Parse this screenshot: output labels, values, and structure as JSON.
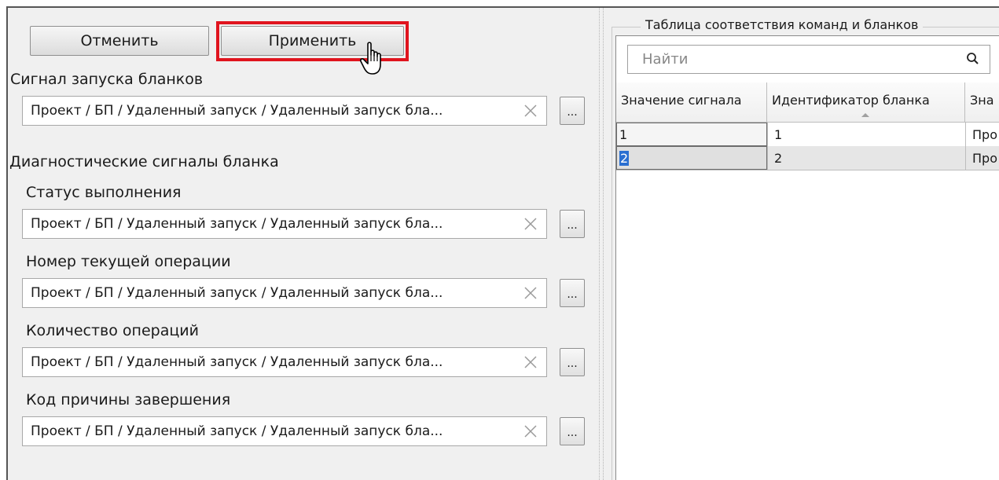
{
  "toolbar": {
    "cancel_label": "Отменить",
    "apply_label": "Применить"
  },
  "left": {
    "start_signal_label": "Сигнал запуска бланков",
    "start_signal_value": "Проект / БП / Удаленный запуск / Удаленный запуск бла...",
    "diag_section_label": "Диагностические сигналы бланка",
    "fields": [
      {
        "label": "Статус выполнения",
        "value": "Проект / БП / Удаленный запуск / Удаленный запуск бла..."
      },
      {
        "label": "Номер текущей операции",
        "value": "Проект / БП / Удаленный запуск / Удаленный запуск бла..."
      },
      {
        "label": "Количество операций",
        "value": "Проект / БП / Удаленный запуск / Удаленный запуск бла..."
      },
      {
        "label": "Код причины завершения",
        "value": "Проект / БП / Удаленный запуск / Удаленный запуск бла..."
      }
    ],
    "browse_label": "..."
  },
  "right": {
    "group_title": "Таблица соответствия команд и бланков",
    "search_placeholder": "Найти",
    "columns": [
      "Значение сигнала",
      "Идентификатор бланка",
      "Зна"
    ],
    "rows": [
      {
        "signal": "1",
        "id": "1",
        "extra": "Про"
      },
      {
        "signal": "2",
        "id": "2",
        "extra": "Про"
      }
    ]
  },
  "colors": {
    "highlight": "#e0141e",
    "selection": "#2a6fd1"
  }
}
